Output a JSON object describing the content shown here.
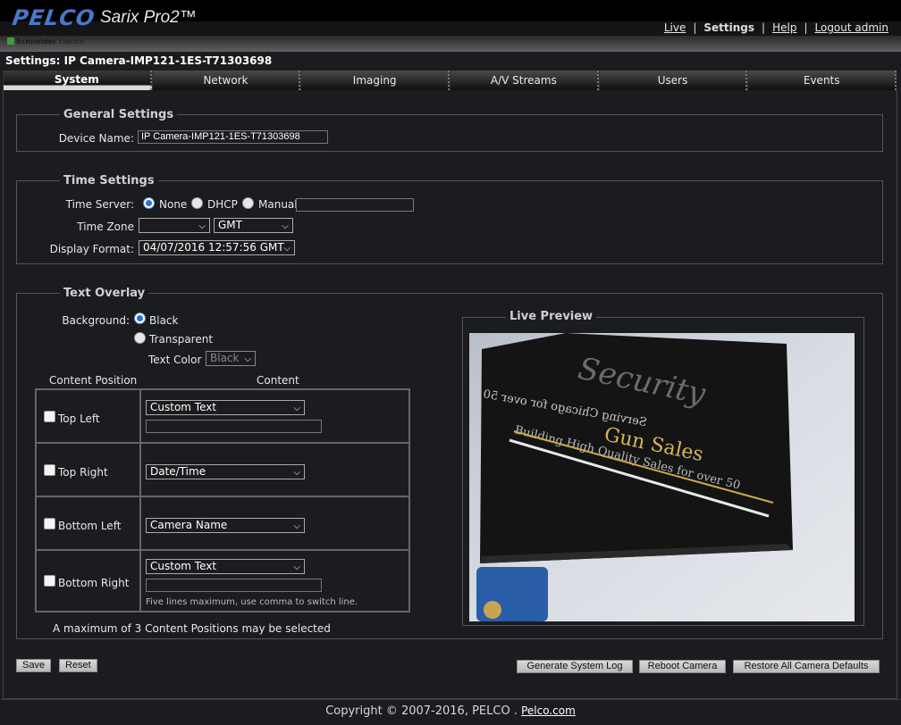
{
  "header": {
    "brand": "PELCO",
    "product": "Sarix Pro2™",
    "sub_brand": "Schneider",
    "sub_brand_2": "Electric",
    "nav": {
      "live": "Live",
      "settings": "Settings",
      "help": "Help",
      "logout": "Logout admin"
    }
  },
  "page": {
    "title": "Settings: IP Camera-IMP121-1ES-T71303698"
  },
  "tabs": [
    {
      "label": "System",
      "active": true
    },
    {
      "label": "Network"
    },
    {
      "label": "Imaging"
    },
    {
      "label": "A/V Streams"
    },
    {
      "label": "Users"
    },
    {
      "label": "Events"
    }
  ],
  "general": {
    "legend": "General Settings",
    "device_name_label": "Device Name:",
    "device_name_value": "IP Camera-IMP121-1ES-T71303698"
  },
  "time": {
    "legend": "Time Settings",
    "server_label": "Time Server:",
    "opt_none": "None",
    "opt_dhcp": "DHCP",
    "opt_manual": "Manual",
    "manual_value": "",
    "zone_label": "Time Zone",
    "zone_region": "",
    "zone_value": "GMT",
    "format_label": "Display Format:",
    "format_value": "04/07/2016 12:57:56 GMT"
  },
  "overlay": {
    "legend": "Text Overlay",
    "background_label": "Background:",
    "bg_black": "Black",
    "bg_transparent": "Transparent",
    "text_color_label": "Text Color",
    "text_color_value": "Black",
    "col_position": "Content Position",
    "col_content": "Content",
    "rows": [
      {
        "position": "Top Left",
        "content": "Custom Text",
        "text": ""
      },
      {
        "position": "Top Right",
        "content": "Date/Time"
      },
      {
        "position": "Bottom Left",
        "content": "Camera Name"
      },
      {
        "position": "Bottom Right",
        "content": "Custom Text",
        "text": "",
        "hint": "Five lines maximum, use comma to switch line."
      }
    ],
    "max_note": "A maximum of 3 Content Positions may be selected"
  },
  "preview": {
    "legend": "Live Preview"
  },
  "buttons": {
    "save": "Save",
    "reset": "Reset",
    "gen_log": "Generate System Log",
    "reboot": "Reboot Camera",
    "restore": "Restore All Camera Defaults"
  },
  "footer": {
    "copyright": "Copyright © 2007-2016, PELCO . ",
    "link": "Pelco.com"
  }
}
